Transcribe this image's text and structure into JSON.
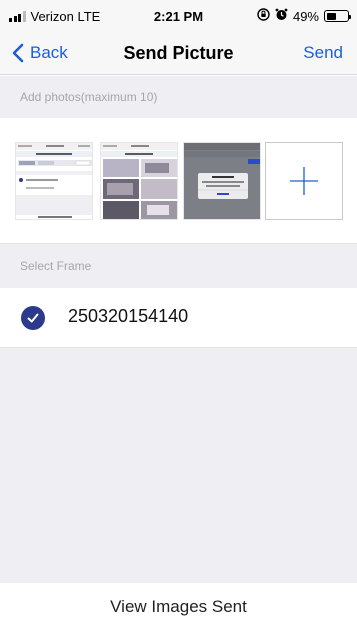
{
  "status_bar": {
    "carrier": "Verizon LTE",
    "time": "2:21 PM",
    "battery": "49%",
    "battery_level": 0.49,
    "icons": [
      "signal-icon",
      "orientation-lock-icon",
      "alarm-icon",
      "battery-icon"
    ]
  },
  "nav": {
    "back_label": "Back",
    "title": "Send Picture",
    "send_label": "Send"
  },
  "photos_section": {
    "header": "Add photos(maximum 10)",
    "thumbnail_count": 3,
    "add_icon": "plus-icon"
  },
  "frame_section": {
    "header": "Select Frame",
    "items": [
      {
        "label": "250320154140",
        "selected": true,
        "icon": "checkmark-icon"
      }
    ]
  },
  "footer": {
    "button_label": "View Images Sent"
  },
  "colors": {
    "accent": "#1a5fd8",
    "check_fill": "#2c3a8c",
    "section_bg": "#efeff3",
    "bar_bg": "#f7f7f7"
  }
}
